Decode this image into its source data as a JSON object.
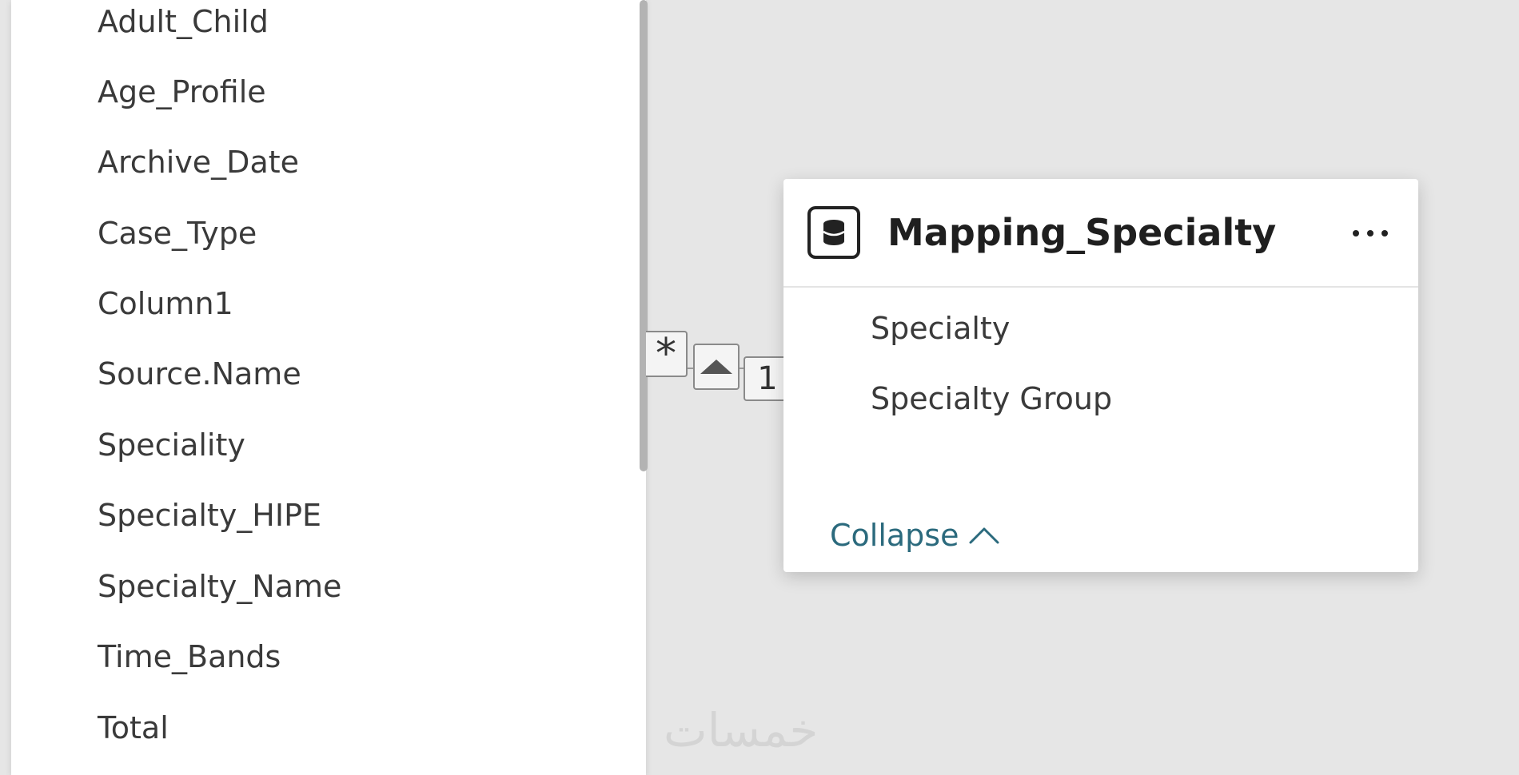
{
  "left_table": {
    "columns": [
      "Adult_Child",
      "Age_Profile",
      "Archive_Date",
      "Case_Type",
      "Column1",
      "Source.Name",
      "Speciality",
      "Specialty_HIPE",
      "Specialty_Name",
      "Time_Bands",
      "Total"
    ]
  },
  "relationship": {
    "many_symbol": "*",
    "one_symbol": "1",
    "direction_icon": "triangle-up-icon"
  },
  "table_card": {
    "icon": "database-icon",
    "title": "Mapping_Specialty",
    "more_icon": "more-horizontal-icon",
    "fields": [
      "Specialty",
      "Specialty Group"
    ],
    "collapse_label": "Collapse",
    "collapse_icon": "chevron-up-icon",
    "collapse_color": "#2b6a7d"
  },
  "watermark": {
    "text": "خمسات"
  }
}
